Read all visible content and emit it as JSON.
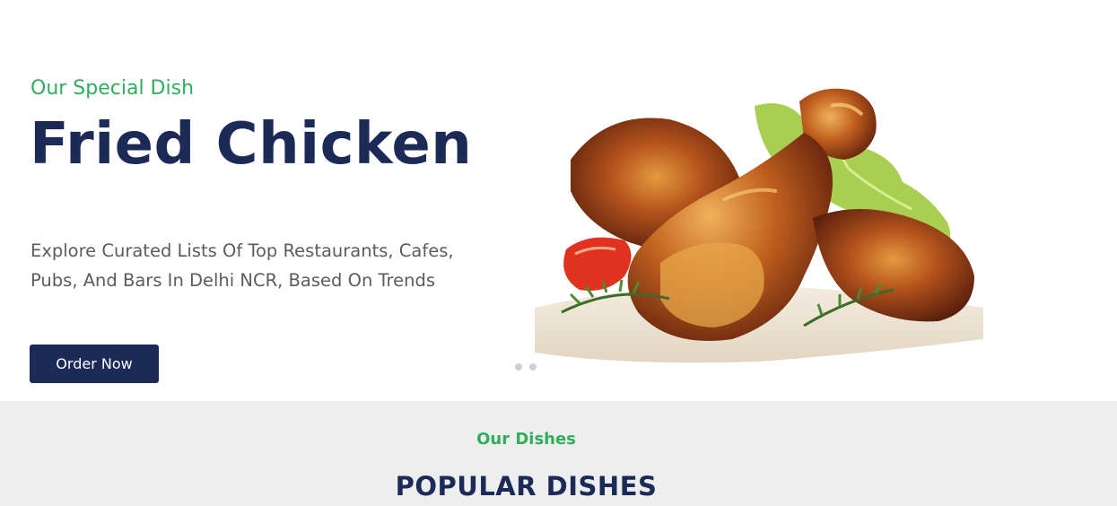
{
  "hero": {
    "eyebrow": "Our Special Dish",
    "title": "Fried Chicken",
    "description": "Explore Curated Lists Of Top Restaurants, Cafes, Pubs, And Bars In Delhi NCR, Based On Trends",
    "cta_label": "Order Now",
    "slider_dots": 2
  },
  "dishes_section": {
    "eyebrow": "Our Dishes",
    "title": "POPULAR DISHES"
  },
  "colors": {
    "accent_green": "#2fae5c",
    "navy": "#1b2a57",
    "section_bg": "#eeeeee"
  }
}
